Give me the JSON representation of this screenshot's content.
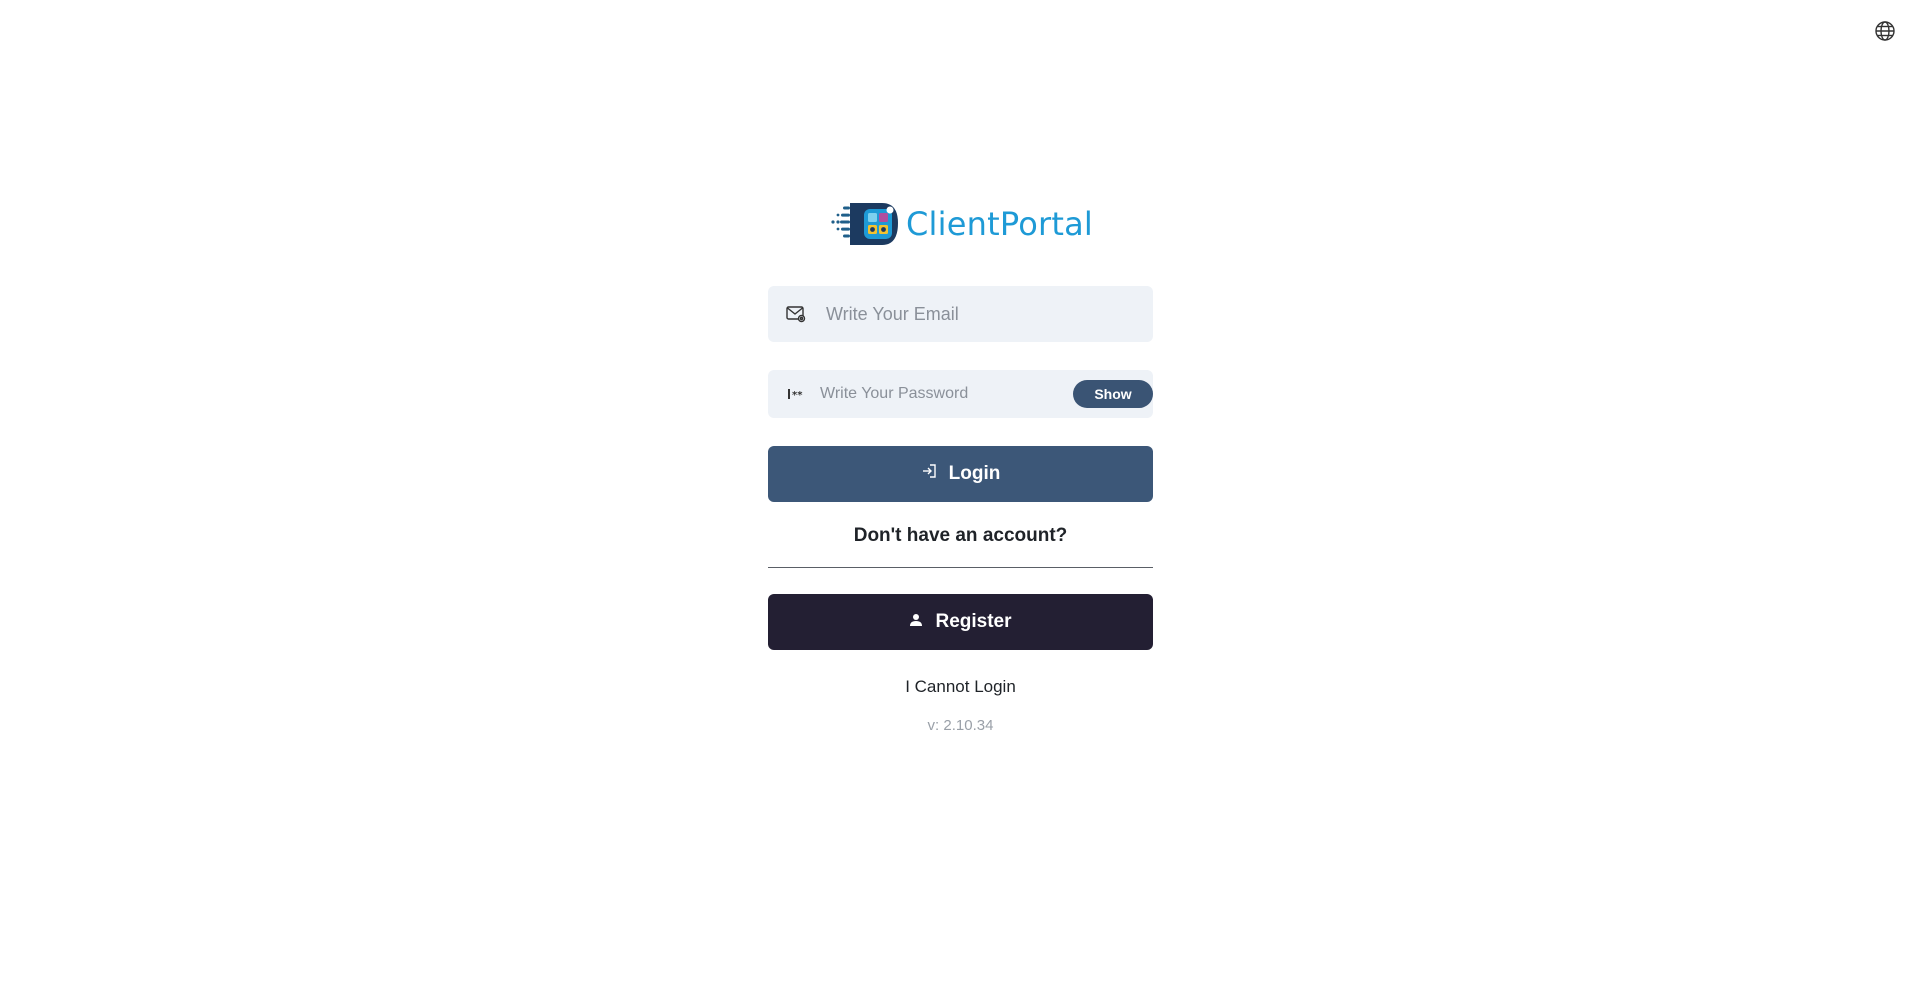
{
  "header": {
    "language_icon": "globe-icon"
  },
  "brand": {
    "name": "ClientPortal",
    "color": "#1e9ad6"
  },
  "form": {
    "email": {
      "icon": "envelope-icon",
      "placeholder": "Write Your Email",
      "value": ""
    },
    "password": {
      "icon": "password-icon",
      "placeholder": "Write Your Password",
      "value": "",
      "show_label": "Show"
    },
    "login_label": "Login",
    "login_icon": "sign-in-icon",
    "no_account_text": "Don't have an account?",
    "register_label": "Register",
    "register_icon": "user-icon",
    "cannot_login_label": "I Cannot Login",
    "version": "v: 2.10.34"
  },
  "colors": {
    "login_button": "#3c5778",
    "register_button": "#231f33",
    "input_background": "#eef2f7",
    "show_button": "#3a5474"
  }
}
